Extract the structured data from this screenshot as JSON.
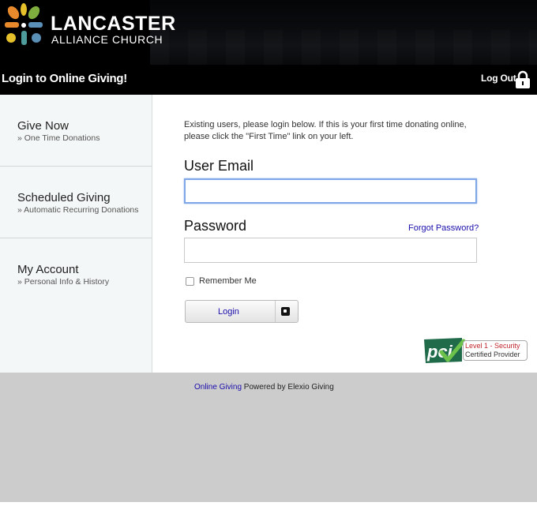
{
  "brand": {
    "name": "LANCASTER",
    "subtitle": "ALLIANCE CHURCH",
    "colors": {
      "orange": "#e88a2c",
      "yellow": "#e5c02a",
      "green": "#7fae3e",
      "blue": "#5a8fb8",
      "teal": "#4e9b9b"
    }
  },
  "header": {
    "title": "Login to Online Giving!",
    "logout_label": "Log Out",
    "logout_icon": "lock-icon"
  },
  "sidebar": {
    "items": [
      {
        "title": "Give Now",
        "subtitle": "» One Time Donations"
      },
      {
        "title": "Scheduled Giving",
        "subtitle": "» Automatic Recurring Donations"
      },
      {
        "title": "My Account",
        "subtitle": "» Personal Info & History"
      }
    ]
  },
  "login": {
    "intro": "Existing users, please login below. If this is your first time donating online, please click the \"First Time\" link on your left.",
    "email_label": "User Email",
    "email_value": "",
    "password_label": "Password",
    "password_value": "",
    "forgot_label": "Forgot Password?",
    "remember_label": "Remember Me",
    "remember_checked": false,
    "button_label": "Login"
  },
  "pci": {
    "logo_text": "pci",
    "line1": "Level 1 - Security",
    "line2": "Certified Provider"
  },
  "footer": {
    "link_text": "Online Giving",
    "text": " Powered by Elexio Giving"
  }
}
